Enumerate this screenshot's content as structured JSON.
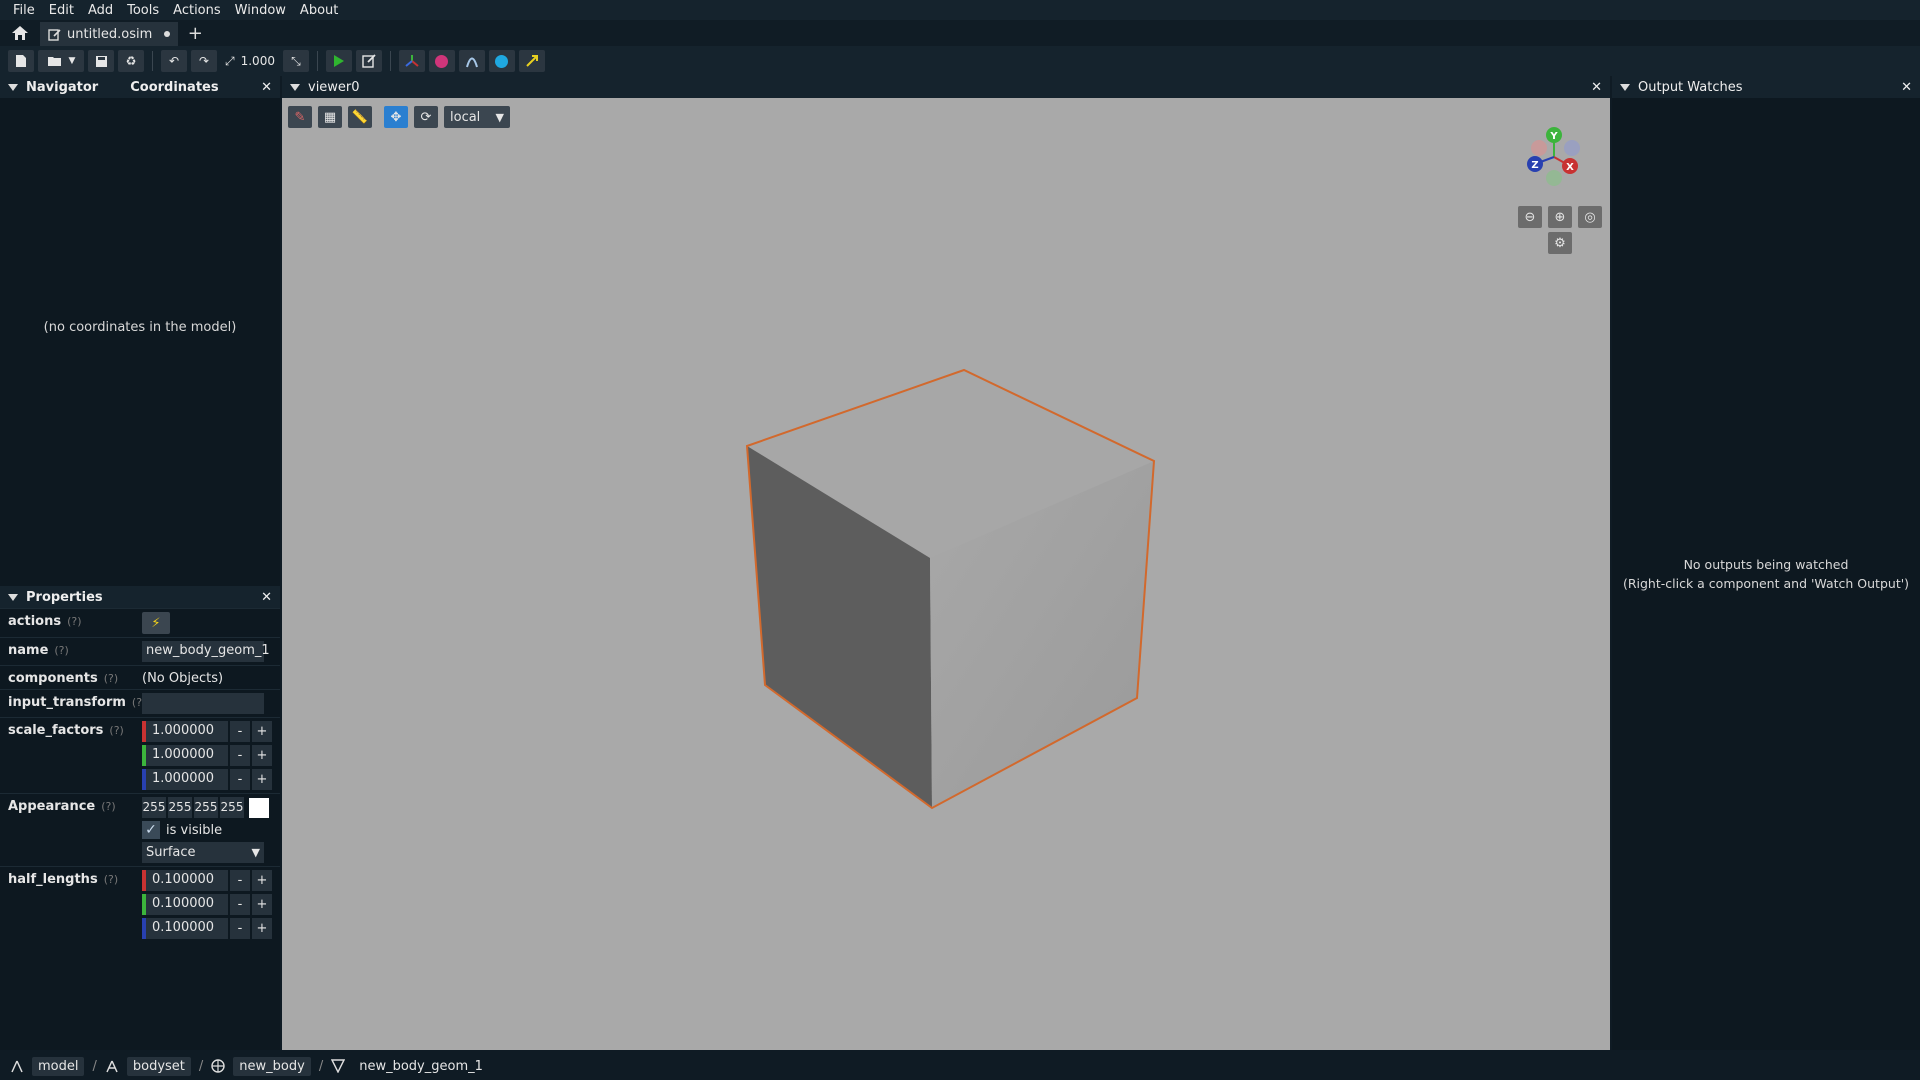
{
  "menu": [
    "File",
    "Edit",
    "Add",
    "Tools",
    "Actions",
    "Window",
    "About"
  ],
  "tab": {
    "title": "untitled.osim",
    "add": "+"
  },
  "toolbar": {
    "scale_value": "1.000"
  },
  "navigator": {
    "tabs": [
      "Navigator",
      "Coordinates"
    ],
    "close": "✕",
    "empty_message": "(no coordinates in the model)"
  },
  "viewer": {
    "title": "viewer0",
    "close": "✕",
    "space": "local"
  },
  "watches": {
    "title": "Output Watches",
    "close": "✕",
    "empty_line1": "No outputs being watched",
    "empty_line2": "(Right-click a component and 'Watch Output')"
  },
  "properties": {
    "title": "Properties",
    "close": "✕",
    "help": "(?)",
    "rows": {
      "actions": "actions",
      "name": "name",
      "name_value": "new_body_geom_1",
      "components": "components",
      "components_value": "(No Objects)",
      "input_transform": "input_transform",
      "scale_factors": "scale_factors",
      "scale_values": [
        "1.000000",
        "1.000000",
        "1.000000"
      ],
      "appearance": "Appearance",
      "rgba": [
        "255",
        "255",
        "255",
        "255"
      ],
      "is_visible": "is visible",
      "representation": "Surface",
      "half_lengths": "half_lengths",
      "half_values": [
        "0.100000",
        "0.100000",
        "0.100000"
      ],
      "minus": "-",
      "plus": "+"
    }
  },
  "breadcrumb": [
    "model",
    "bodyset",
    "new_body",
    "new_body_geom_1"
  ],
  "colors": {
    "x_axis": "#c83232",
    "y_axis": "#3cb43c",
    "z_axis": "#2840b0",
    "selection": "#d2692d"
  }
}
